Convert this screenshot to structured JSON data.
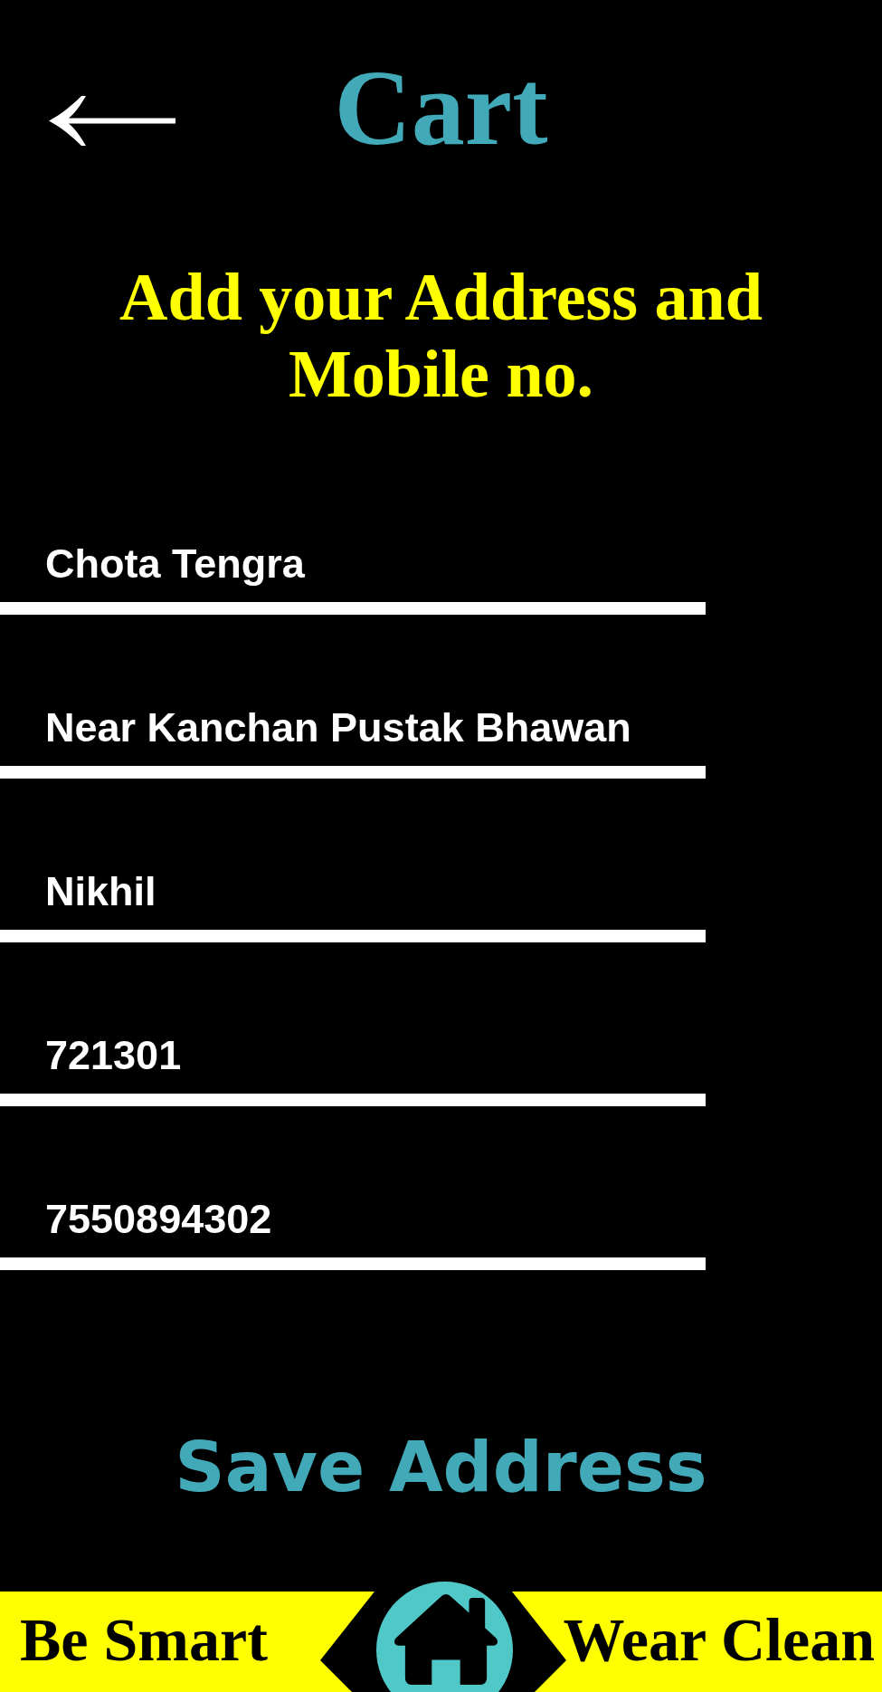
{
  "header": {
    "title": "Cart"
  },
  "heading": "Add your Address and Mobile no.",
  "fields": [
    {
      "value": "Chota Tengra"
    },
    {
      "value": "Near Kanchan Pustak Bhawan"
    },
    {
      "value": "Nikhil"
    },
    {
      "value": "721301"
    },
    {
      "value": "7550894302"
    }
  ],
  "save_button": {
    "label": "Save Address"
  },
  "footer": {
    "left_text": "Be Smart",
    "right_text": "Wear Clean"
  }
}
